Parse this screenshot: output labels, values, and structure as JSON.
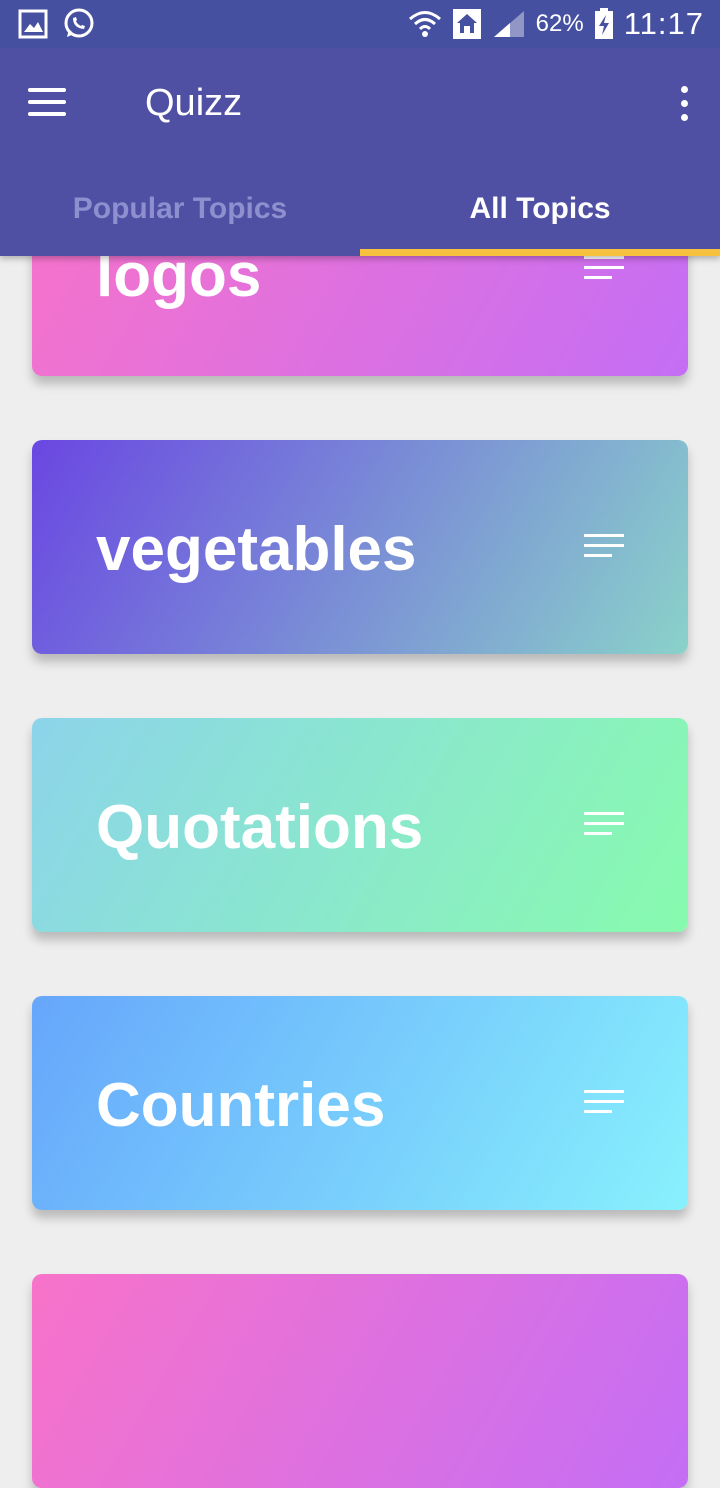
{
  "status_bar": {
    "battery_percent": "62%",
    "time": "11:17",
    "icons": [
      "gallery-icon",
      "whatsapp-icon",
      "wifi-icon",
      "home-icon",
      "signal-icon",
      "battery-charging-icon"
    ]
  },
  "app_bar": {
    "title": "Quizz",
    "menu_icon": "hamburger-menu-icon",
    "overflow_icon": "more-vert-icon"
  },
  "tabs": [
    {
      "label": "Popular Topics",
      "active": false
    },
    {
      "label": "All Topics",
      "active": true
    }
  ],
  "colors": {
    "status_bar": "#4650a0",
    "app_bar": "#4f4fa3",
    "tab_indicator": "#f6c13e",
    "inactive_tab_text": "#8d8fcf",
    "background": "#eeeeee"
  },
  "topics": [
    {
      "label": "logos",
      "gradient": [
        "#f873c9",
        "#c46ef5"
      ]
    },
    {
      "label": "vegetables",
      "gradient": [
        "#6a47e2",
        "#8ad2ca"
      ]
    },
    {
      "label": "Quotations",
      "gradient": [
        "#8cd4ea",
        "#88fbae"
      ]
    },
    {
      "label": "Countries",
      "gradient": [
        "#66a6fb",
        "#88f1fd"
      ]
    },
    {
      "label": "",
      "gradient": [
        "#f873c9",
        "#c46ef5"
      ]
    }
  ]
}
